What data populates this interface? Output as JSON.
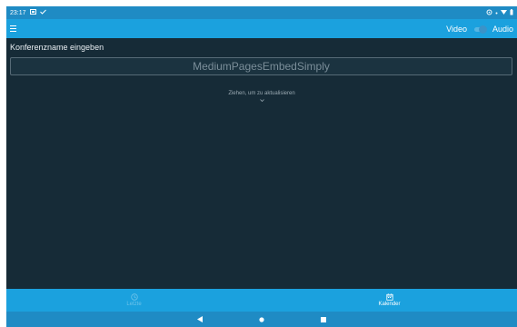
{
  "status_bar": {
    "time": "23:17"
  },
  "toolbar": {
    "video_label": "Video",
    "audio_label": "Audio"
  },
  "main": {
    "conference_label": "Konferenzname eingeben",
    "conference_placeholder": "MediumPagesEmbedSimply",
    "pull_to_refresh": "Ziehen, um zu aktualisieren"
  },
  "bottom_nav": {
    "tabs": [
      {
        "label": "Letzte",
        "icon": "clock-icon",
        "active": false
      },
      {
        "label": "Kalender",
        "icon": "calendar-icon",
        "active": true
      }
    ]
  },
  "colors": {
    "background": "#162b37",
    "accent": "#1ba1de",
    "status_bar": "#1f8bc4"
  }
}
